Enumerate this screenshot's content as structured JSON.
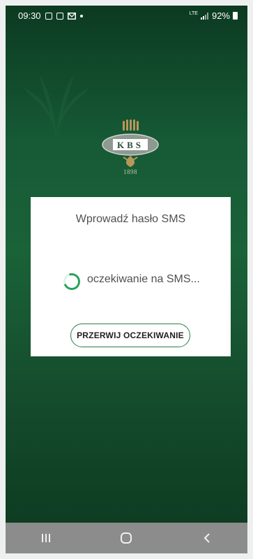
{
  "status_bar": {
    "time": "09:30",
    "network": "LTE",
    "battery": "92%"
  },
  "logo": {
    "text": "KBS",
    "year": "1898"
  },
  "dialog": {
    "title": "Wprowadź hasło SMS",
    "waiting_text": "oczekiwanie na SMS...",
    "cancel_button_label": "PRZERWIJ OCZEKIWANIE"
  },
  "nav_bar": {
    "items": [
      "recent-apps-icon",
      "home-icon",
      "back-icon"
    ]
  },
  "colors": {
    "background_green": "#1a6238",
    "accent_green": "#27a25b",
    "dialog_bg": "#ffffff",
    "nav_bar": "#8c8c8c"
  }
}
